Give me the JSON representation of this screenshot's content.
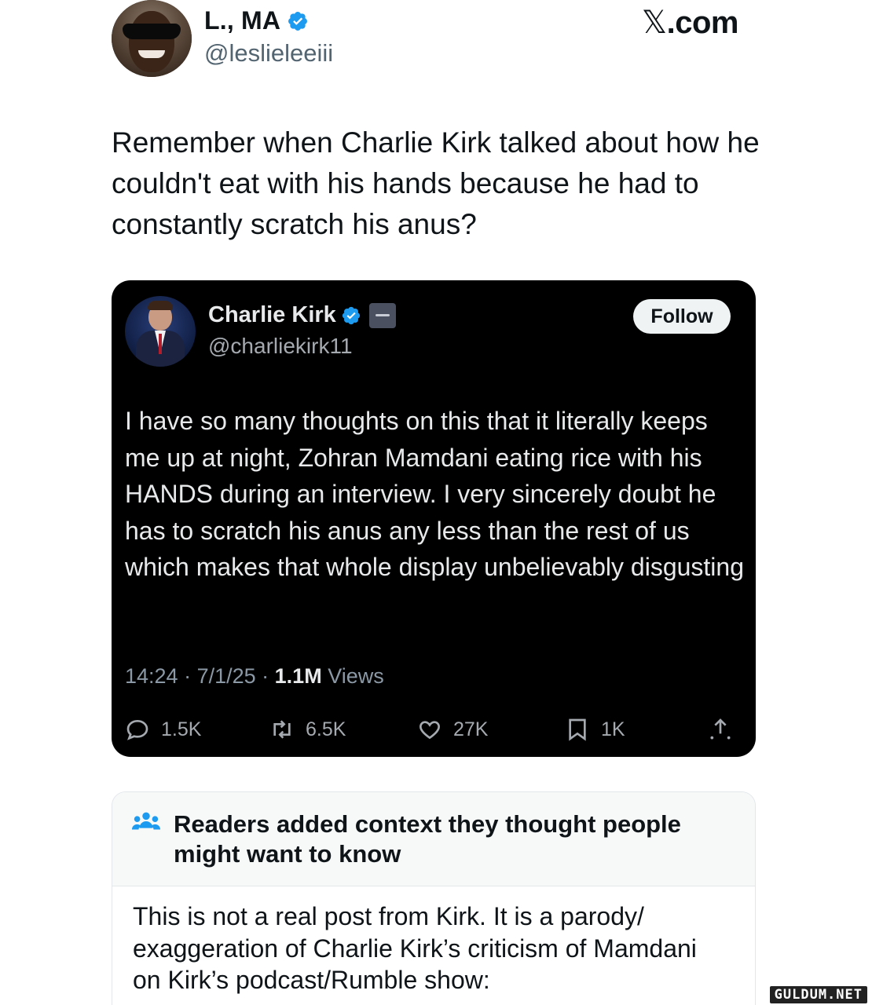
{
  "outer_post": {
    "display_name": "L., MA",
    "handle": "@leslieleeiii",
    "site": "X.com",
    "text": "Remember when Charlie Kirk talked about how he couldn't eat with his hands because he had to constantly scratch his anus?"
  },
  "quoted_post": {
    "display_name": "Charlie Kirk",
    "handle": "@charliekirk11",
    "follow_label": "Follow",
    "text": "I have so many thoughts on this that it literally keeps me up at night, Zohran Mamdani eating rice with his HANDS during an interview. I very sincerely doubt he has to scratch his anus any less than the rest of us which makes that whole display unbelievably disgusting",
    "time": "14:24",
    "date": "7/1/25",
    "views_count": "1.1M",
    "views_label": "Views",
    "replies": "1.5K",
    "reposts": "6.5K",
    "likes": "27K",
    "bookmarks": "1K"
  },
  "community_note": {
    "title": "Readers added context they thought people might want to know",
    "body": "This is not a real post from Kirk.  It is a parody/ exaggeration of Charlie Kirk’s criticism of Mamdani on Kirk’s podcast/Rumble show:"
  },
  "watermark": "GULDUM.NET",
  "colors": {
    "verified_blue": "#1d9bf0",
    "embed_bg": "#000000",
    "note_header_bg": "#f7f9f9"
  },
  "icons": [
    "verified-badge-icon",
    "reply-icon",
    "repost-icon",
    "like-icon",
    "bookmark-icon",
    "share-icon",
    "community-notes-icon"
  ]
}
